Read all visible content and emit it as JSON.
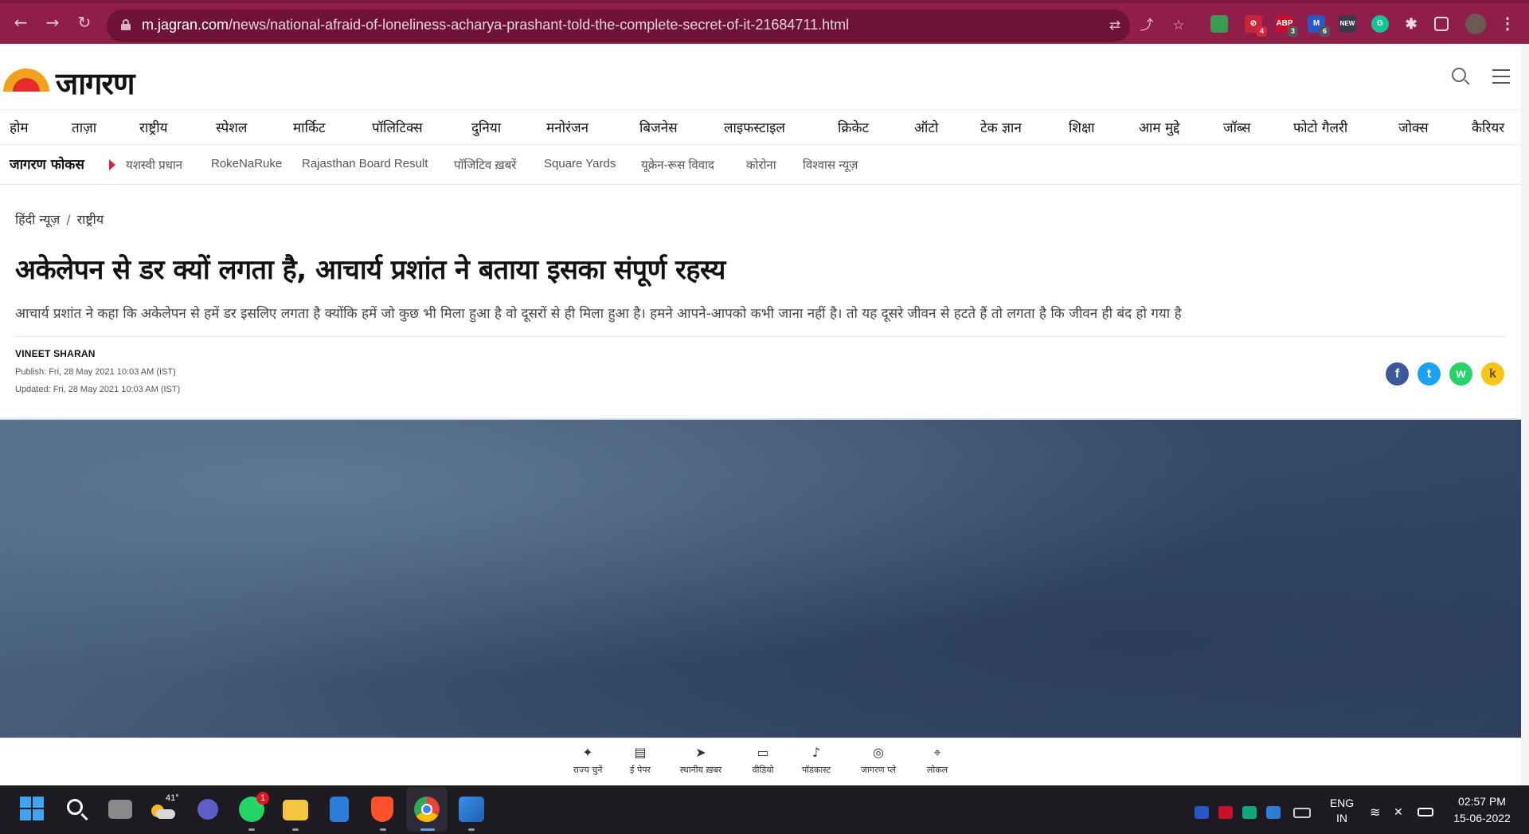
{
  "browser": {
    "url_host": "m.jagran.com",
    "url_path": "/news/national-afraid-of-loneliness-acharya-prashant-told-the-complete-secret-of-it-21684711.html",
    "extensions": [
      {
        "name": "translate-icon"
      },
      {
        "name": "share-icon"
      },
      {
        "name": "bookmark-star-icon"
      }
    ],
    "ext_badges": {
      "ext1": "4",
      "abp": "3",
      "ext3": "6",
      "ext4": "NEW"
    }
  },
  "site": {
    "logo_text": "जागरण",
    "nav": [
      "होम",
      "ताज़ा",
      "राष्ट्रीय",
      "स्पेशल",
      "मार्किट",
      "पॉलिटिक्स",
      "दुनिया",
      "मनोरंजन",
      "बिजनेस",
      "लाइफस्टाइल",
      "क्रिकेट",
      "ऑटो",
      "टेक ज्ञान",
      "शिक्षा",
      "आम मुद्दे",
      "जॉब्स",
      "फोटो गैलरी",
      "जोक्स",
      "कैरियर"
    ],
    "focus_title": "जागरण फोकस",
    "focus_items": [
      "यशस्वी प्रधान",
      "RokeNaRuke",
      "Rajasthan Board Result",
      "पॉजिटिव ख़बरें",
      "Square Yards",
      "यूक्रेन-रूस विवाद",
      "कोरोना",
      "विश्वास न्यूज़"
    ]
  },
  "article": {
    "breadcrumb": [
      "हिंदी न्यूज़",
      "राष्ट्रीय"
    ],
    "breadcrumb_sep": "/",
    "headline": "अकेलेपन से डर क्यों लगता है, आचार्य प्रशांत ने बताया इसका संपूर्ण रहस्य",
    "summary": "आचार्य प्रशांत ने कहा कि अकेलेपन से हमें डर इसलिए लगता है क्योंकि हमें जो कुछ भी मिला हुआ है वो दूसरों से ही मिला हुआ है। हमने आपने-आपको कभी जाना नहीं है। तो यह दूसरे जीवन से हटते हैं तो लगता है कि जीवन ही बंद हो गया है",
    "author": "VINEET SHARAN",
    "published": "Publish: Fri, 28 May 2021 10:03 AM (IST)",
    "updated": "Updated: Fri, 28 May 2021 10:03 AM (IST)",
    "share": {
      "facebook": "f",
      "twitter": "t",
      "whatsapp": "w",
      "koo": "k"
    }
  },
  "bottom_nav": [
    {
      "label": "राज्य चुनें",
      "icon": "map-india-icon",
      "glyph": "✦"
    },
    {
      "label": "ई पेपर",
      "icon": "document-icon",
      "glyph": "▤"
    },
    {
      "label": "स्थानीय ख़बर",
      "icon": "navigation-arrow-icon",
      "glyph": "➤"
    },
    {
      "label": "वीडियो",
      "icon": "video-camera-icon",
      "glyph": "▭"
    },
    {
      "label": "पॉडकास्ट",
      "icon": "microphone-icon",
      "glyph": "♪"
    },
    {
      "label": "जागरण प्ले",
      "icon": "gamepad-icon",
      "glyph": "◎"
    },
    {
      "label": "लोकल",
      "icon": "location-pin-icon",
      "glyph": "⌖"
    }
  ],
  "taskbar": {
    "weather_temp": "41°",
    "whatsapp_badge": "1",
    "lang_line1": "ENG",
    "lang_line2": "IN",
    "time": "02:57 PM",
    "date": "15-06-2022"
  },
  "colors": {
    "browser_frame": "#8f1e4a",
    "brand_red": "#d9253b",
    "brand_orange": "#f0a31a",
    "facebook": "#3b5998",
    "twitter": "#1da1f2",
    "whatsapp": "#25d366",
    "koo": "#f5c518"
  }
}
